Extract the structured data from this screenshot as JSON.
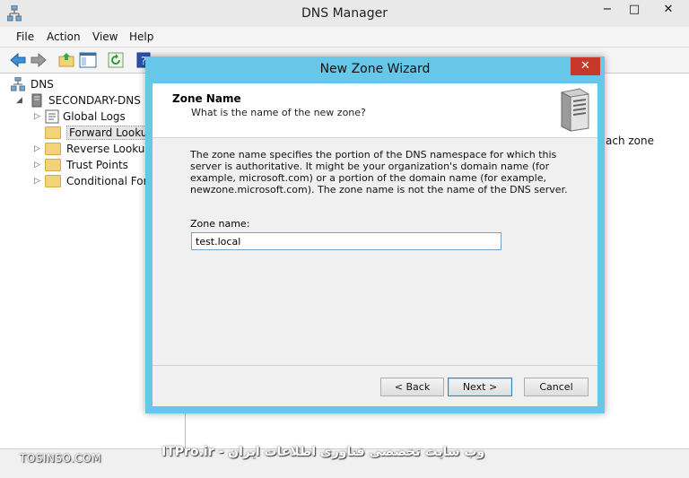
{
  "window": {
    "title": "DNS Manager",
    "controls": {
      "minimize": "−",
      "maximize": "□",
      "close": "✕"
    }
  },
  "menu": [
    "File",
    "Action",
    "View",
    "Help"
  ],
  "toolbar": {
    "icons": [
      "back-arrow-icon",
      "forward-arrow-icon",
      "up-folder-icon",
      "show-hide-tree-icon",
      "refresh-icon",
      "help-icon"
    ]
  },
  "tree": {
    "root": "DNS",
    "server": "SECONDARY-DNS",
    "items": [
      "Global Logs",
      "Forward Lookup Z",
      "Reverse Lookup Z",
      "Trust Points",
      "Conditional Forw"
    ]
  },
  "right_pane": {
    "partial_text": "ach zone"
  },
  "dialog": {
    "title": "New Zone Wizard",
    "close": "✕",
    "header_title": "Zone Name",
    "header_subtitle": "What is the name of the new zone?",
    "description": "The zone name specifies the portion of the DNS namespace for which this server is authoritative. It might be your organization's domain name (for example,  microsoft.com) or a portion of the domain name (for example, newzone.microsoft.com). The zone name is not the name of the DNS server.",
    "zone_label": "Zone name:",
    "zone_value": "test.local",
    "buttons": {
      "back": "< Back",
      "next": "Next >",
      "cancel": "Cancel"
    }
  },
  "footer": {
    "left": "TOSINSO.COM",
    "right": "وب سایت تخصصی فناوری اطلاعات ایران - ITPro.ir"
  },
  "colors": {
    "dialog_frame": "#67c7e8",
    "close_button": "#c7382b",
    "folder": "#f3d27a"
  }
}
